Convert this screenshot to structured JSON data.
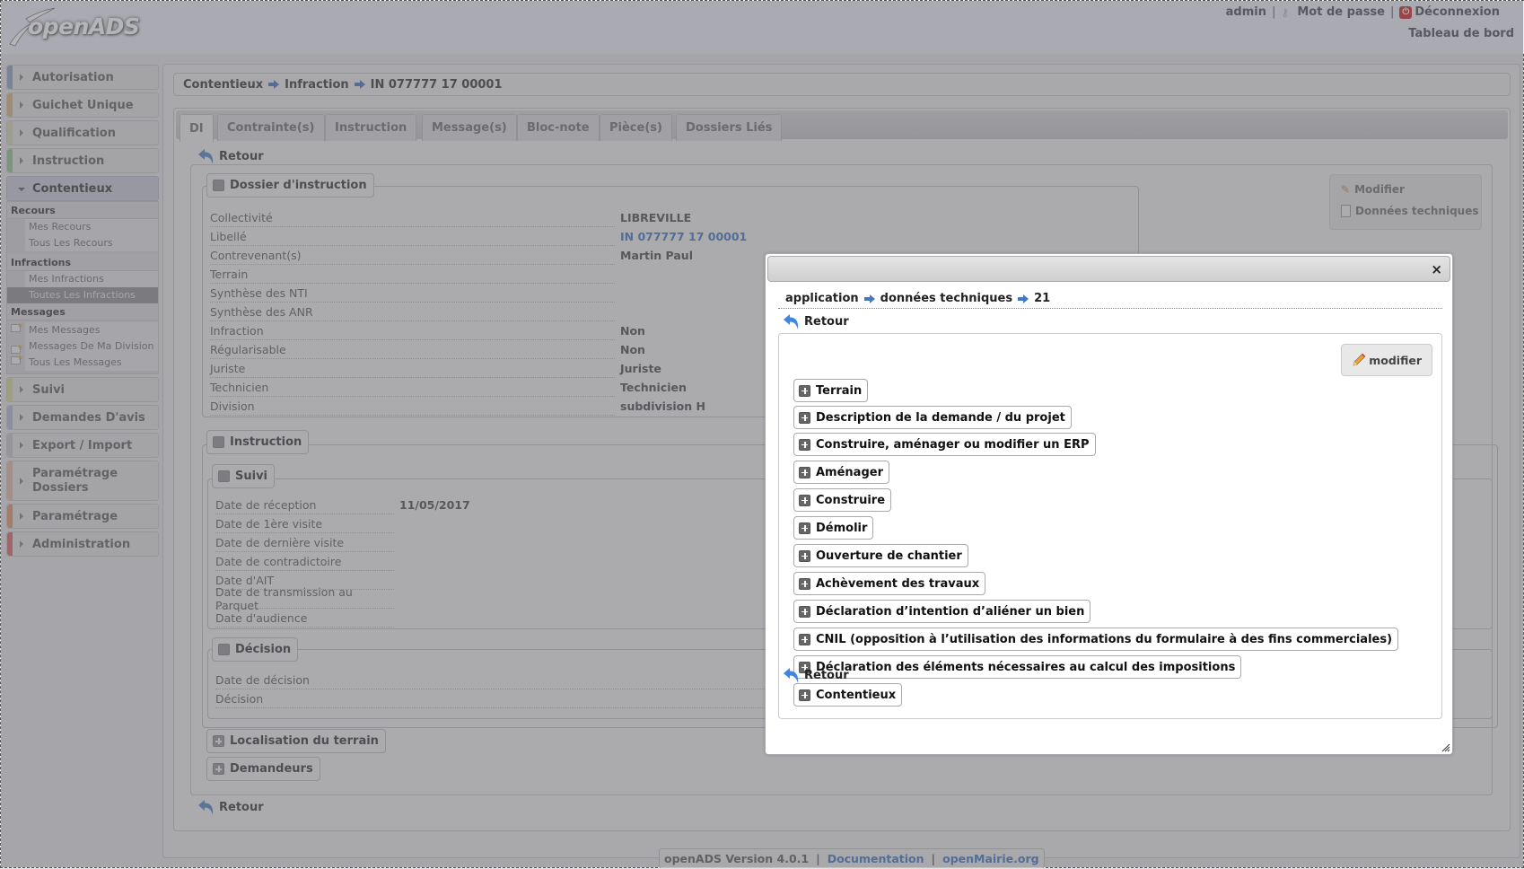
{
  "header": {
    "logo_text": "openADS",
    "user": "admin",
    "password_link": "Mot de passe",
    "logout_link": "Déconnexion",
    "dashboard_link": "Tableau de bord"
  },
  "sidebar": {
    "items": [
      {
        "label": "Autorisation",
        "color": "#9fb6d6"
      },
      {
        "label": "Guichet Unique",
        "color": "#e8c68e"
      },
      {
        "label": "Qualification",
        "color": "#e4e4c0"
      },
      {
        "label": "Instruction",
        "color": "#a8d4a0"
      },
      {
        "label": "Contentieux",
        "color": "#c8c8d8"
      },
      {
        "label": "Suivi",
        "color": "#e6e6a8"
      },
      {
        "label": "Demandes D'avis",
        "color": "#c0cce0"
      },
      {
        "label": "Export / Import",
        "color": "#d8d8d8"
      },
      {
        "label": "Paramétrage Dossiers",
        "color": "#f0c8b8"
      },
      {
        "label": "Paramétrage",
        "color": "#f0a880"
      },
      {
        "label": "Administration",
        "color": "#e88080"
      }
    ],
    "contentieux_sub": {
      "recours_head": "Recours",
      "recours": [
        "Mes Recours",
        "Tous Les Recours"
      ],
      "infractions_head": "Infractions",
      "infractions": [
        "Mes Infractions",
        "Toutes Les Infractions"
      ],
      "messages_head": "Messages",
      "messages": [
        "Mes Messages",
        "Messages De Ma Division",
        "Tous Les Messages"
      ]
    }
  },
  "breadcrumb": [
    "Contentieux",
    "Infraction",
    "IN 077777 17 00001"
  ],
  "tabs": [
    "DI",
    "Contrainte(s)",
    "Instruction",
    "Message(s)",
    "Bloc-note",
    "Pièce(s)",
    "Dossiers Liés"
  ],
  "retour_label": "Retour",
  "dossier": {
    "legend": "Dossier d'instruction",
    "fields": [
      {
        "label": "Collectivité",
        "value": "LIBREVILLE"
      },
      {
        "label": "Libellé",
        "value": "IN 077777 17 00001"
      },
      {
        "label": "Contrevenant(s)",
        "value": "Martin Paul"
      },
      {
        "label": "Terrain",
        "value": ""
      },
      {
        "label": "Synthèse des NTI",
        "value": ""
      },
      {
        "label": "Synthèse des ANR",
        "value": ""
      },
      {
        "label": "Infraction",
        "value": "Non"
      },
      {
        "label": "Régularisable",
        "value": "Non"
      },
      {
        "label": "Juriste",
        "value": "Juriste"
      },
      {
        "label": "Technicien",
        "value": "Technicien"
      },
      {
        "label": "Division",
        "value": "subdivision H"
      }
    ]
  },
  "instruction": {
    "legend": "Instruction",
    "suivi_legend": "Suivi",
    "suivi_fields": [
      {
        "label": "Date de réception",
        "value": "11/05/2017"
      },
      {
        "label": "Date de 1ère visite",
        "value": ""
      },
      {
        "label": "Date de dernière visite",
        "value": ""
      },
      {
        "label": "Date de contradictoire",
        "value": ""
      },
      {
        "label": "Date d'AIT",
        "value": ""
      },
      {
        "label": "Date de transmission au Parquet",
        "value": ""
      },
      {
        "label": "Date d'audience",
        "value": ""
      }
    ],
    "decision_legend": "Décision",
    "decision_fields": [
      {
        "label": "Date de décision",
        "value": ""
      },
      {
        "label": "Décision",
        "value": ""
      }
    ]
  },
  "collapsed_sections": [
    "Localisation du terrain",
    "Demandeurs"
  ],
  "side_actions": {
    "modifier": "Modifier",
    "donnees_techniques": "Données techniques"
  },
  "footer": {
    "version": "openADS Version 4.0.1",
    "sep": "|",
    "documentation": "Documentation",
    "openmairie": "openMairie.org"
  },
  "dialog": {
    "close_icon": "×",
    "breadcrumb": [
      "application",
      "données techniques",
      "21"
    ],
    "retour_label": "Retour",
    "modifier_label": "modifier",
    "sections": [
      "Terrain",
      "Description de la demande / du projet",
      "Construire, aménager ou modifier un ERP",
      "Aménager",
      "Construire",
      "Démolir",
      "Ouverture de chantier",
      "Achèvement des travaux",
      "Déclaration d’intention d’aliéner un bien",
      "CNIL (opposition à l’utilisation des informations du formulaire à des fins commerciales)",
      "Déclaration des éléments nécessaires au calcul des impositions",
      "Contentieux"
    ]
  }
}
